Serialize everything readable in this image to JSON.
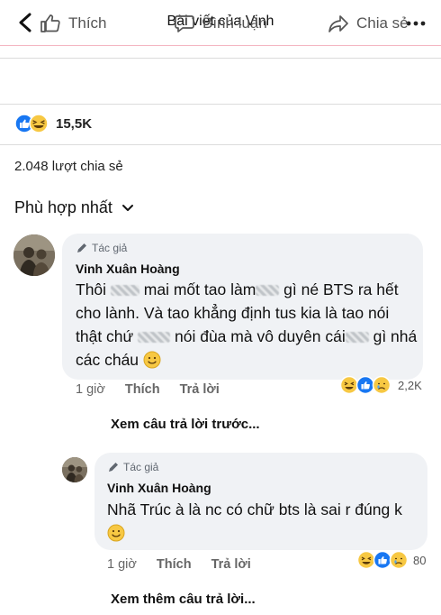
{
  "header": {
    "title": "Bài viết của Vinh"
  },
  "actions": {
    "like": "Thích",
    "comment": "Bình luận",
    "share": "Chia sẻ"
  },
  "reactions": {
    "count": "15,5K"
  },
  "shares": "2.048 lượt chia sẻ",
  "sort": {
    "label": "Phù hợp nhất"
  },
  "comments": [
    {
      "badge": "Tác giả",
      "author": "Vinh Xuân Hoàng",
      "text_1": "Thôi",
      "text_2": "mai mốt tao làm",
      "text_3": "gì né BTS ra hết  cho lành.  Và tao khẳng định tus kia là tao nói thật chứ",
      "text_4": "nói đùa mà vô duyên cái",
      "text_5": "gì nhá các cháu",
      "time": "1 giờ",
      "like": "Thích",
      "reply": "Trả lời",
      "reaction_count": "2,2K"
    },
    {
      "badge": "Tác giả",
      "author": "Vinh Xuân Hoàng",
      "text": "Nhã Trúc à là nc có chữ bts là sai r đúng k",
      "time": "1 giờ",
      "like": "Thích",
      "reply": "Trả lời",
      "reaction_count": "80"
    }
  ],
  "view_previous": "Xem câu trả lời trước...",
  "view_more": "Xem thêm câu trả lời...",
  "colors": {
    "like_blue": "#1877f2",
    "haha_yellow": "#f7c843",
    "text_gray": "#666666"
  }
}
